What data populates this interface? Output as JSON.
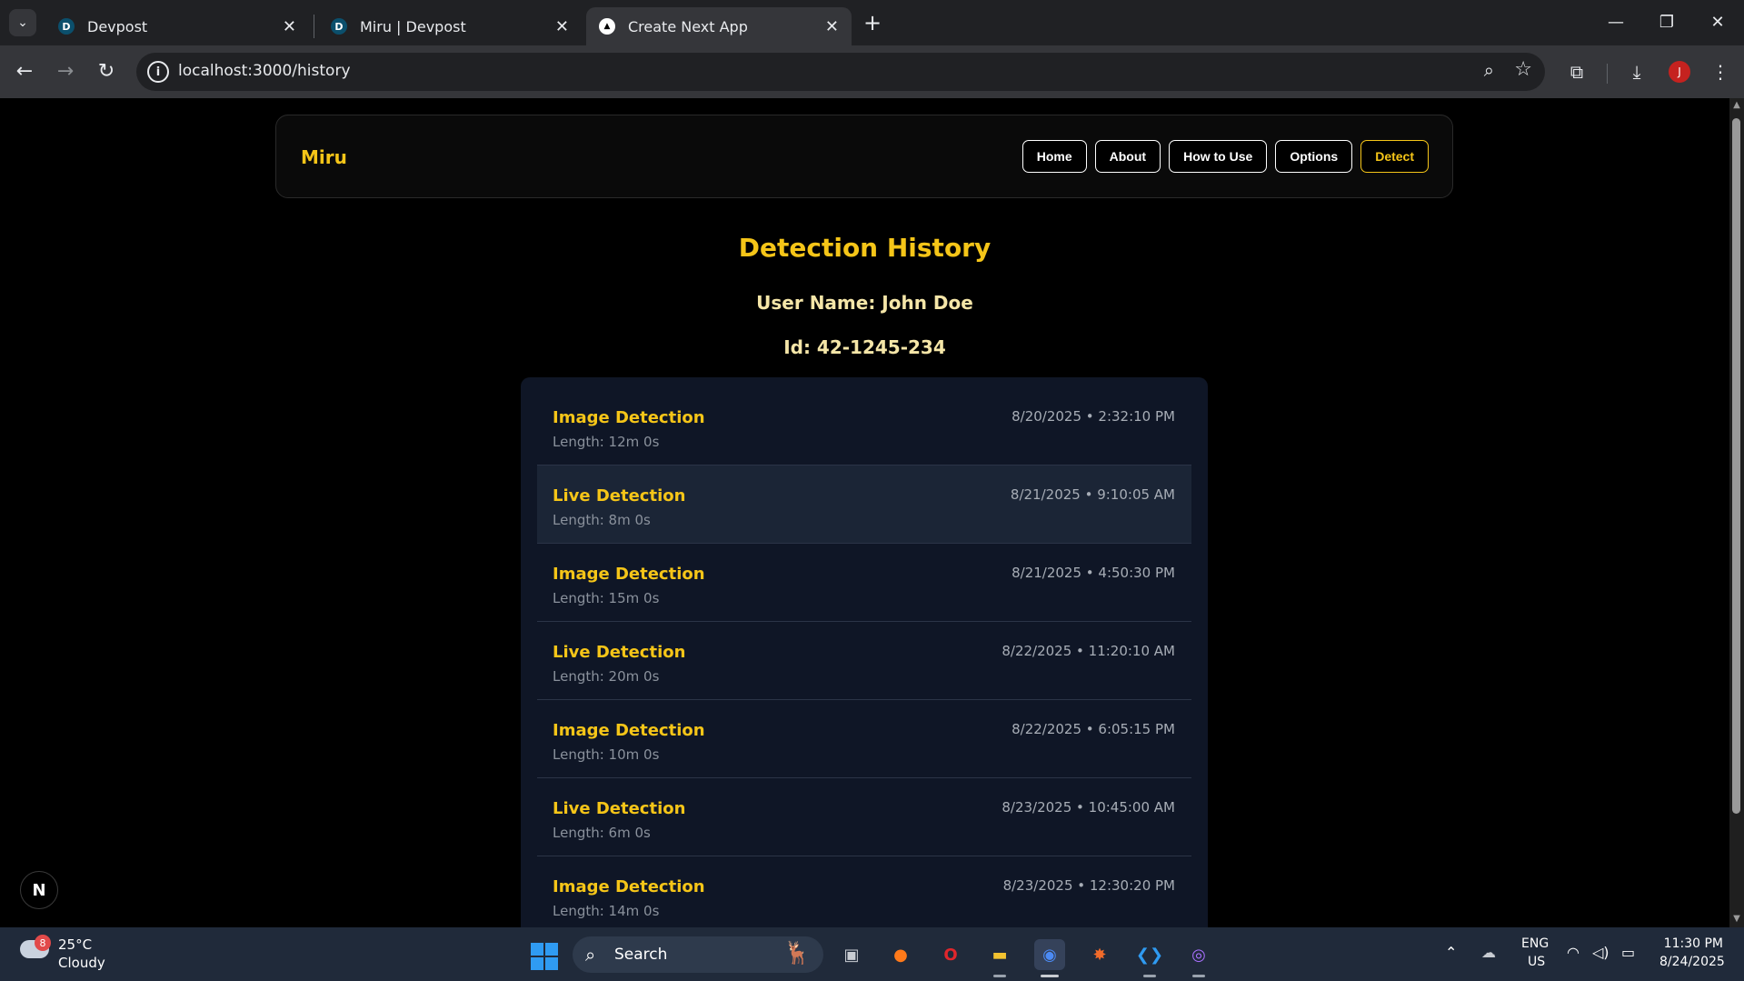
{
  "browser": {
    "tabs": [
      {
        "favicon": "D",
        "title": "Devpost",
        "active": false
      },
      {
        "favicon": "D",
        "title": "Miru | Devpost",
        "active": false
      },
      {
        "favicon": "▲",
        "title": "Create Next App",
        "active": true
      }
    ],
    "url": "localhost:3000/history",
    "profile_initial": "J"
  },
  "app": {
    "brand": "Miru",
    "nav": [
      {
        "label": "Home"
      },
      {
        "label": "About"
      },
      {
        "label": "How to Use"
      },
      {
        "label": "Options"
      },
      {
        "label": "Detect"
      }
    ],
    "title": "Detection History",
    "user_name": "User Name: John Doe",
    "user_id": "Id: 42-1245-234",
    "history": [
      {
        "type": "Image Detection",
        "length": "Length: 12m 0s",
        "timestamp": "8/20/2025 • 2:32:10 PM"
      },
      {
        "type": "Live Detection",
        "length": "Length: 8m 0s",
        "timestamp": "8/21/2025 • 9:10:05 AM"
      },
      {
        "type": "Image Detection",
        "length": "Length: 15m 0s",
        "timestamp": "8/21/2025 • 4:50:30 PM"
      },
      {
        "type": "Live Detection",
        "length": "Length: 20m 0s",
        "timestamp": "8/22/2025 • 11:20:10 AM"
      },
      {
        "type": "Image Detection",
        "length": "Length: 10m 0s",
        "timestamp": "8/22/2025 • 6:05:15 PM"
      },
      {
        "type": "Live Detection",
        "length": "Length: 6m 0s",
        "timestamp": "8/23/2025 • 10:45:00 AM"
      },
      {
        "type": "Image Detection",
        "length": "Length: 14m 0s",
        "timestamp": "8/23/2025 • 12:30:20 PM"
      }
    ],
    "dev_badge": "N"
  },
  "taskbar": {
    "weather_badge": "8",
    "temperature": "25°C",
    "condition": "Cloudy",
    "search_label": "Search",
    "lang": "ENG",
    "region": "US",
    "time": "11:30 PM",
    "date": "8/24/2025"
  },
  "colors": {
    "accent": "#f5c518",
    "panel": "#0f1626",
    "highlight_row": "#1b2536"
  }
}
